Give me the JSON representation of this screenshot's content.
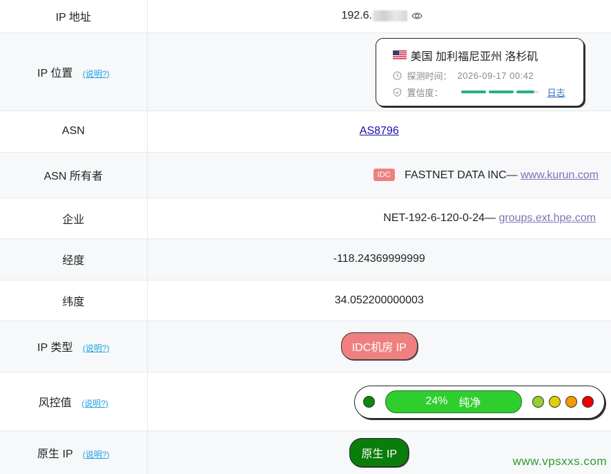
{
  "rows": {
    "ip": {
      "label": "IP 地址",
      "value_prefix": "192.6."
    },
    "location": {
      "label": "IP 位置",
      "help": "(说明?)",
      "flag": "us-flag",
      "place": "美国 加利福尼亚州 洛杉矶",
      "probe_label": "探测时间：",
      "probe_time": "2026-09-17 00:42",
      "confidence_label": "置信度：",
      "confidence_level": 0.95,
      "log_link": "日志"
    },
    "asn": {
      "label": "ASN",
      "value": "AS8796"
    },
    "asn_owner": {
      "label": "ASN 所有者",
      "badge": "IDC",
      "name": "FASTNET DATA INC—",
      "link": "www.kurun.com"
    },
    "enterprise": {
      "label": "企业",
      "name": "NET-192-6-120-0-24—",
      "link": "groups.ext.hpe.com"
    },
    "longitude": {
      "label": "经度",
      "value": "-118.24369999999"
    },
    "latitude": {
      "label": "纬度",
      "value": "34.052200000003"
    },
    "ip_type": {
      "label": "IP 类型",
      "help": "(说明?)",
      "value": "IDC机房 IP"
    },
    "risk": {
      "label": "风控值",
      "help": "(说明?)",
      "percent": "24%",
      "status": "纯净",
      "colors": {
        "active": "#0a8a0a",
        "c1": "#9acd32",
        "c2": "#e0d000",
        "c3": "#f29a00",
        "c4": "#ee0000"
      }
    },
    "native": {
      "label": "原生 IP",
      "help": "(说明?)",
      "value": "原生 IP"
    }
  },
  "watermark": "www.vpsxxs.com"
}
